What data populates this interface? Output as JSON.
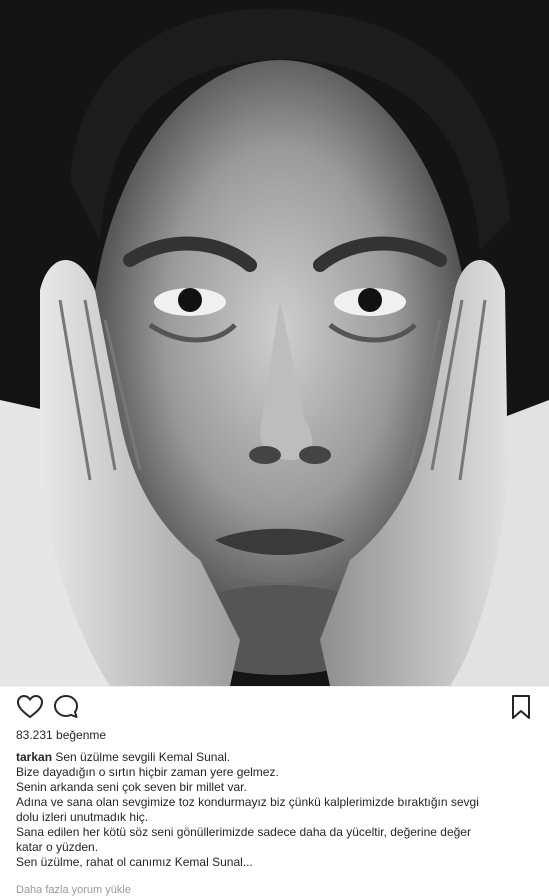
{
  "post": {
    "likes": "83.231 beğenme",
    "username": "tarkan",
    "caption_lines": [
      "Sen üzülme sevgili Kemal Sunal.",
      "Bize dayadığın o sırtın hiçbir zaman yere gelmez.",
      "Senin arkanda seni çok seven bir millet var.",
      "Adına ve sana olan sevgimize toz kondurmayız biz çünkü kalplerimizde bıraktığın sevgi",
      "dolu izleri unutmadık hiç.",
      "Sana edilen her kötü söz seni gönüllerimizde sadece daha da yüceltir, değerine değer",
      "katar o yüzden.",
      "Sen üzülme, rahat ol canımız Kemal Sunal..."
    ],
    "more_comments": "Daha fazla yorum yükle"
  },
  "icons": {
    "like": "heart-icon",
    "comment": "comment-icon",
    "save": "bookmark-icon"
  },
  "colors": {
    "text": "#262626",
    "muted": "#999999",
    "background": "#ffffff"
  }
}
